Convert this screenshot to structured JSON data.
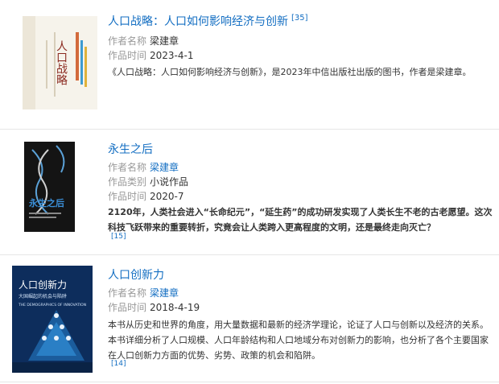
{
  "works": [
    {
      "title": "人口战略：人口如何影响经济与创新",
      "ref": "[35]",
      "fields": [
        {
          "label": "作者名称",
          "value": "梁建章"
        },
        {
          "label": "作品时间",
          "value": "2023-4-1"
        }
      ],
      "description": "《人口战略：人口如何影响经济与创新》，是2023年中信出版社出版的图书，作者是梁建章。",
      "cover": {
        "title_text": "人口战略",
        "bg": "#f5f2ea",
        "accent": "#c0392b"
      }
    },
    {
      "title": "永生之后",
      "fields": [
        {
          "label": "作者名称",
          "value": "梁建章"
        },
        {
          "label": "作品类别",
          "value": "小说作品"
        },
        {
          "label": "作品时间",
          "value": "2020-7"
        }
      ],
      "description": "2120年，人类社会进入“长命纪元”，“延生药”的成功研发实现了人类长生不老的古老愿望。这次科技飞跃带来的重要转折，究竟会让人类跨入更高程度的文明，还是最终走向灭亡？",
      "ref": "[15]",
      "cover": {
        "title_text": "永生之后",
        "bg": "#1a1a1a",
        "accent": "#2a6fb0"
      }
    },
    {
      "title": "人口创新力",
      "fields": [
        {
          "label": "作者名称",
          "value": "梁建章"
        },
        {
          "label": "作品时间",
          "value": "2018-4-19"
        }
      ],
      "description": "本书从历史和世界的角度，用大量数据和最新的经济学理论，论证了人口与创新以及经济的关系。本书详细分析了人口规模、人口年龄结构和人口地域分布对创新力的影响，也分析了各个主要国家在人口创新力方面的优势、劣势、政策的机会和陷阱。",
      "ref": "[14]",
      "cover": {
        "title_text": "人口创新力",
        "subtitle": "大国崛起的机会与陷阱",
        "en_title": "THE DEMOGRAPHICS OF INNOVATION",
        "bg": "#0d2d5c",
        "accent": "#1f7fc0"
      }
    }
  ]
}
